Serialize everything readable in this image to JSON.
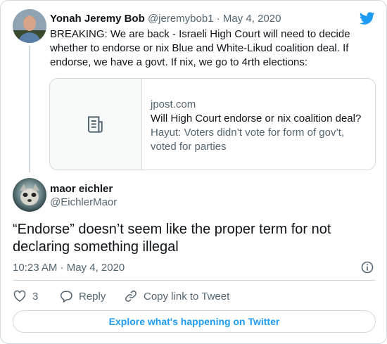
{
  "parent_tweet": {
    "author_name": "Yonah Jeremy Bob",
    "author_handle": "@jeremybob1",
    "separator": "·",
    "date": "May 4, 2020",
    "text": "BREAKING: We are back - Israeli High Court will need to decide whether to endorse or nix Blue and White-Likud coalition deal. If endorse, we have a govt. If nix, we go to 4rth elections:",
    "link_card": {
      "domain": "jpost.com",
      "title": "Will High Court endorse or nix coalition deal?",
      "description": "Hayut: Voters didn’t vote for form of gov’t, voted for parties"
    }
  },
  "main_tweet": {
    "author_name": "maor eichler",
    "author_handle": "@EichlerMaor",
    "text": "“Endorse” doesn’t seem like the proper term for not declaring something illegal",
    "timestamp": "10:23 AM · May 4, 2020"
  },
  "actions": {
    "like_count": "3",
    "reply_label": "Reply",
    "copy_label": "Copy link to Tweet"
  },
  "explore_label": "Explore what's happening on Twitter",
  "colors": {
    "accent": "#1d9bf0",
    "text_primary": "#0f1419",
    "text_secondary": "#536471",
    "border": "#cfd9de"
  },
  "icons": [
    "twitter-bird-icon",
    "document-icon",
    "info-icon",
    "heart-icon",
    "reply-bubble-icon",
    "link-icon"
  ]
}
